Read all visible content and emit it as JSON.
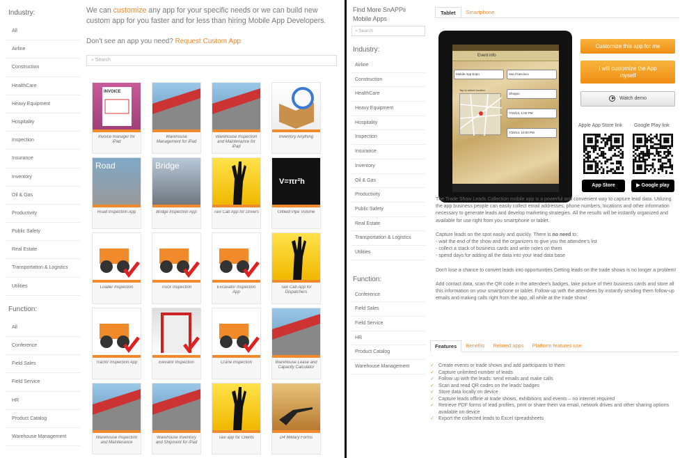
{
  "left": {
    "industry_heading": "Industry:",
    "industries": [
      "All",
      "Airline",
      "Construction",
      "HealthCare",
      "Heavy Equipment",
      "Hospitality",
      "Inspection",
      "Insurance",
      "Inventory",
      "Oil & Gas",
      "Productivity",
      "Public Safety",
      "Real Estate",
      "Transportation & Logistics",
      "Utilities"
    ],
    "function_heading": "Function:",
    "functions": [
      "All",
      "Conference",
      "Field Sales",
      "Field Service",
      "HR",
      "Product Catalog",
      "Warehouse Management"
    ],
    "intro_pre": "We can ",
    "intro_link": "customize",
    "intro_post": " any app for your specific needs or we can build new custom app for you faster and for less than hiring Mobile App Developers.",
    "request_pre": "Don't see an app you need? ",
    "request_link": "Request Custom App",
    "search_placeholder": "Search",
    "apps": [
      {
        "caption": "Invoice manager for iPad",
        "icon": "invoice-icon",
        "img_text": "INVOICE"
      },
      {
        "caption": "Warehouse Management for iPad",
        "icon": "warehouse-icon",
        "img_text": ""
      },
      {
        "caption": "Warehouse Inspection and Maintenance for iPad",
        "icon": "warehouse-magnifier-icon",
        "img_text": ""
      },
      {
        "caption": "Inventory Anything",
        "icon": "box-check-icon",
        "img_text": ""
      },
      {
        "caption": "Road Inspection App",
        "icon": "road-icon",
        "img_text": "Road"
      },
      {
        "caption": "Bridge Inspection App",
        "icon": "bridge-icon",
        "img_text": "Bridge"
      },
      {
        "caption": "Taxi Cab App for Drivers",
        "icon": "hand-raised-icon",
        "img_text": ""
      },
      {
        "caption": "Oilfield Pipe Volume",
        "icon": "formula-icon",
        "img_text": "V=πr²h"
      },
      {
        "caption": "Loader Inspection",
        "icon": "loader-icon",
        "img_text": ""
      },
      {
        "caption": "Truck Inspection",
        "icon": "truck-icon",
        "img_text": ""
      },
      {
        "caption": "Excavator Inspection App",
        "icon": "excavator-icon",
        "img_text": ""
      },
      {
        "caption": "Taxi Cab App for Dispatchers",
        "icon": "hand-raised-icon",
        "img_text": ""
      },
      {
        "caption": "Tractor Inspection App",
        "icon": "tractor-icon",
        "img_text": ""
      },
      {
        "caption": "Elevator Inspection",
        "icon": "elevator-icon",
        "img_text": ""
      },
      {
        "caption": "Crane Inspection",
        "icon": "crane-icon",
        "img_text": ""
      },
      {
        "caption": "Warehouse Lease and Capacity Calculator",
        "icon": "warehouse-calculator-icon",
        "img_text": ""
      },
      {
        "caption": "Warehouse Inspection and Maintenance",
        "icon": "warehouse-magnifier-icon",
        "img_text": ""
      },
      {
        "caption": "Warehouse Inventory and Shipment for iPad",
        "icon": "warehouse-icon",
        "img_text": ""
      },
      {
        "caption": "Taxi app for Clients",
        "icon": "hand-raised-icon",
        "img_text": ""
      },
      {
        "caption": "D4 Military Forms",
        "icon": "soldier-icon",
        "img_text": ""
      }
    ]
  },
  "right": {
    "find_title": "Find More SnAPPii Mobile Apps",
    "search_placeholder": "Search",
    "industry_heading": "Industry:",
    "industries": [
      "Airline",
      "Construction",
      "HealthCare",
      "Heavy Equipment",
      "Hospitality",
      "Inspection",
      "Insurance",
      "Inventory",
      "Oil & Gas",
      "Productivity",
      "Public Safety",
      "Real Estate",
      "Transportation & Logistics",
      "Utilities"
    ],
    "function_heading": "Function:",
    "functions": [
      "Conference",
      "Field Sales",
      "Field Service",
      "HR",
      "Product Catalog",
      "Warehouse Management"
    ],
    "device_tabs": [
      "Tablet",
      "Smartphone"
    ],
    "tablet": {
      "header": "Event info",
      "fields": [
        "Mobile App Expo",
        "San Francisco",
        "Shoppo",
        "7/18/14, 1:00 PM",
        "7/20/14, 10:00 PM"
      ],
      "map_label": "Tap to select location"
    },
    "btn_customize": "Customize this app for me",
    "btn_will_customize": "I will customize the App myself",
    "btn_watch": "Watch demo",
    "apple_label": "Apple App Store link",
    "google_label": "Google Play link",
    "apple_badge": "App Store",
    "google_badge": "Google play",
    "desc_first": "The Trade Show Leads Collection mobile app is a powerful and convenient way to capture lead data. Utilizing the app business people can easily collect email addresses, phone numbers, locations and other information necessary to generate leads and develop marketing strategies. All the results will be instantly organized and available for use right from you smartphone or tablet.",
    "desc_capture_pre": "Capture leads on the spot easily and quickly. There is ",
    "desc_capture_bold": "no need",
    "desc_capture_post": " to:",
    "desc_bullets": [
      "- wait the end of the show and the organizers to give you the attendee's list",
      "- collect a stack of business cards and write notes on them",
      "- spend days for adding all the data into your lead data base"
    ],
    "desc_convert": "Don't lose a chance to convert leads into opportunities Getting leads on the trade shows is no longer a problem!",
    "desc_add": "Add contact data, scan the QR code in the attendee's badges, take picture of their business cards and store all this information on your smartphone or tablet. Follow-up with the attendees by instantly sending them follow-up emails and making calls right from the app, all while at the trade show!",
    "feature_tabs": [
      "Features",
      "Benefits",
      "Related apps",
      "Platform features use"
    ],
    "features": [
      "Create events or trade shows and add participants to them",
      "Capture unlimited number of leads",
      "Follow up with the leads: send emails and make calls",
      "Scan and read QR codes on the leads' badges",
      "Store data locally on device",
      "Capture leads offline at trade shows, exhibitions and events – no internet required",
      "Retrieve PDF forms of lead profiles, print or share them via email, network drives and other sharing options available on device",
      "Export the collected leads to Excel spreadsheets"
    ]
  },
  "colors": {
    "accent": "#f08a2a",
    "button_orange": "#f5a623",
    "divider": "#111111"
  }
}
